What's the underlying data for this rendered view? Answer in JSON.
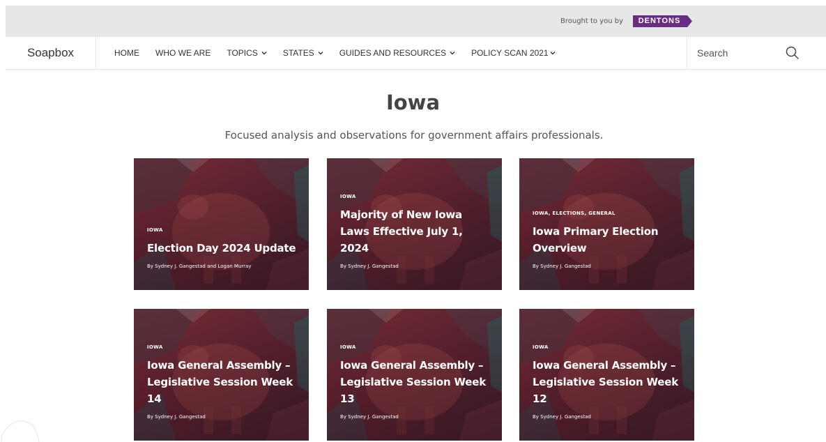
{
  "sponsor": {
    "brought_label": "Brought to you by",
    "brand": "DENTONS",
    "brand_color": "#6b2d83"
  },
  "nav": {
    "logo": "Soapbox",
    "items": [
      {
        "label": "HOME",
        "dropdown": false
      },
      {
        "label": "WHO WE ARE",
        "dropdown": false
      },
      {
        "label": "TOPICS",
        "dropdown": true
      },
      {
        "label": "STATES",
        "dropdown": true
      },
      {
        "label": "GUIDES AND RESOURCES",
        "dropdown": true
      },
      {
        "label": "POLICY SCAN 2021",
        "dropdown": true
      }
    ],
    "search_placeholder": "Search",
    "search_icon": "search-icon"
  },
  "page": {
    "title": "Iowa",
    "subtitle": "Focused analysis and observations for government affairs professionals."
  },
  "cards": [
    {
      "tag": "IOWA",
      "title": "Election Day 2024 Update",
      "byline": "By Sydney J. Gangestad and Logan Murray"
    },
    {
      "tag": "IOWA",
      "title": "Majority of New Iowa Laws Effective July 1, 2024",
      "byline": "By Sydney J. Gangestad"
    },
    {
      "tag": "IOWA, ELECTIONS, GENERAL",
      "title": "Iowa Primary Election Overview",
      "byline": "By Sydney J. Gangestad"
    },
    {
      "tag": "IOWA",
      "title": "Iowa General Assembly – Legislative Session Week 14",
      "byline": "By Sydney J. Gangestad"
    },
    {
      "tag": "IOWA",
      "title": "Iowa General Assembly – Legislative Session Week 13",
      "byline": "By Sydney J. Gangestad"
    },
    {
      "tag": "IOWA",
      "title": "Iowa General Assembly – Legislative Session Week 12",
      "byline": "By Sydney J. Gangestad"
    }
  ]
}
